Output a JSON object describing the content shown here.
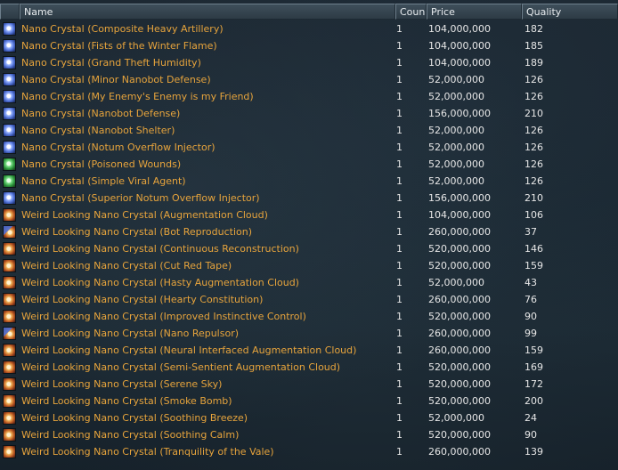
{
  "columns": {
    "name": "Name",
    "count": "Coun",
    "price": "Price",
    "quality": "Quality"
  },
  "rows": [
    {
      "icon": "blue",
      "name": "Nano Crystal (Composite Heavy Artillery)",
      "count": "1",
      "price": "104,000,000",
      "quality": "182"
    },
    {
      "icon": "blue",
      "name": "Nano Crystal (Fists of the Winter Flame)",
      "count": "1",
      "price": "104,000,000",
      "quality": "185"
    },
    {
      "icon": "blue",
      "name": "Nano Crystal (Grand Theft Humidity)",
      "count": "1",
      "price": "104,000,000",
      "quality": "189"
    },
    {
      "icon": "blue",
      "name": "Nano Crystal (Minor Nanobot Defense)",
      "count": "1",
      "price": "52,000,000",
      "quality": "126"
    },
    {
      "icon": "blue",
      "name": "Nano Crystal (My Enemy's Enemy is my Friend)",
      "count": "1",
      "price": "52,000,000",
      "quality": "126"
    },
    {
      "icon": "blue",
      "name": "Nano Crystal (Nanobot Defense)",
      "count": "1",
      "price": "156,000,000",
      "quality": "210"
    },
    {
      "icon": "blue",
      "name": "Nano Crystal (Nanobot Shelter)",
      "count": "1",
      "price": "52,000,000",
      "quality": "126"
    },
    {
      "icon": "blue",
      "name": "Nano Crystal (Notum Overflow Injector)",
      "count": "1",
      "price": "52,000,000",
      "quality": "126"
    },
    {
      "icon": "green",
      "name": "Nano Crystal (Poisoned Wounds)",
      "count": "1",
      "price": "52,000,000",
      "quality": "126"
    },
    {
      "icon": "green",
      "name": "Nano Crystal (Simple Viral Agent)",
      "count": "1",
      "price": "52,000,000",
      "quality": "126"
    },
    {
      "icon": "blue",
      "name": "Nano Crystal (Superior Notum Overflow Injector)",
      "count": "1",
      "price": "156,000,000",
      "quality": "210"
    },
    {
      "icon": "orange",
      "name": "Weird Looking Nano Crystal (Augmentation Cloud)",
      "count": "1",
      "price": "104,000,000",
      "quality": "106"
    },
    {
      "icon": "orangeblue",
      "name": "Weird Looking Nano Crystal (Bot Reproduction)",
      "count": "1",
      "price": "260,000,000",
      "quality": "37"
    },
    {
      "icon": "orange",
      "name": "Weird Looking Nano Crystal (Continuous Reconstruction)",
      "count": "1",
      "price": "520,000,000",
      "quality": "146"
    },
    {
      "icon": "orange",
      "name": "Weird Looking Nano Crystal (Cut Red Tape)",
      "count": "1",
      "price": "520,000,000",
      "quality": "159"
    },
    {
      "icon": "orange",
      "name": "Weird Looking Nano Crystal (Hasty Augmentation Cloud)",
      "count": "1",
      "price": "52,000,000",
      "quality": "43"
    },
    {
      "icon": "orange",
      "name": "Weird Looking Nano Crystal (Hearty Constitution)",
      "count": "1",
      "price": "260,000,000",
      "quality": "76"
    },
    {
      "icon": "orange",
      "name": "Weird Looking Nano Crystal (Improved Instinctive Control)",
      "count": "1",
      "price": "520,000,000",
      "quality": "90"
    },
    {
      "icon": "orangeblue",
      "name": "Weird Looking Nano Crystal (Nano Repulsor)",
      "count": "1",
      "price": "260,000,000",
      "quality": "99"
    },
    {
      "icon": "orange",
      "name": "Weird Looking Nano Crystal (Neural Interfaced Augmentation Cloud)",
      "count": "1",
      "price": "260,000,000",
      "quality": "159"
    },
    {
      "icon": "orange",
      "name": "Weird Looking Nano Crystal (Semi-Sentient Augmentation Cloud)",
      "count": "1",
      "price": "520,000,000",
      "quality": "169"
    },
    {
      "icon": "orange",
      "name": "Weird Looking Nano Crystal (Serene Sky)",
      "count": "1",
      "price": "520,000,000",
      "quality": "172"
    },
    {
      "icon": "orange",
      "name": "Weird Looking Nano Crystal (Smoke Bomb)",
      "count": "1",
      "price": "520,000,000",
      "quality": "200"
    },
    {
      "icon": "orange",
      "name": "Weird Looking Nano Crystal (Soothing Breeze)",
      "count": "1",
      "price": "52,000,000",
      "quality": "24"
    },
    {
      "icon": "orange",
      "name": "Weird Looking Nano Crystal (Soothing Calm)",
      "count": "1",
      "price": "520,000,000",
      "quality": "90"
    },
    {
      "icon": "orange",
      "name": "Weird Looking Nano Crystal (Tranquility of the Vale)",
      "count": "1",
      "price": "260,000,000",
      "quality": "139"
    }
  ]
}
